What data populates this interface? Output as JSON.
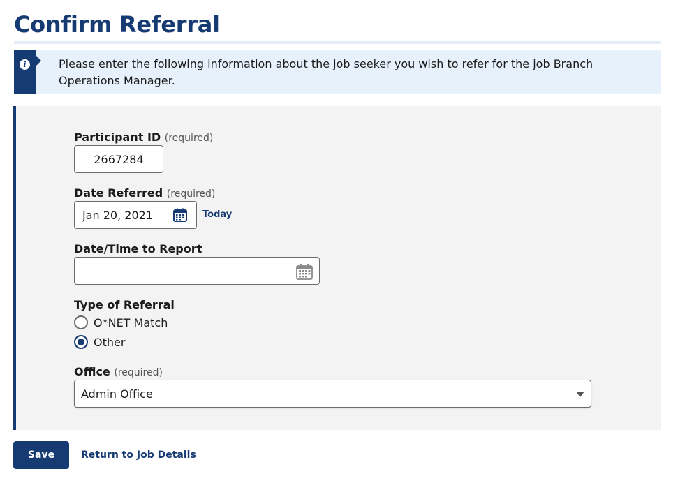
{
  "page": {
    "title": "Confirm Referral"
  },
  "alert": {
    "icon": "info-icon",
    "message": "Please enter the following information about the job seeker you wish to refer for the job Branch Operations Manager."
  },
  "form": {
    "participant_id": {
      "label": "Participant ID",
      "required_note": "(required)",
      "value": "2667284"
    },
    "date_referred": {
      "label": "Date Referred",
      "required_note": "(required)",
      "value": "Jan 20, 2021",
      "calendar_icon": "calendar-icon",
      "today_link": "Today"
    },
    "date_time_to_report": {
      "label": "Date/Time to Report",
      "value": "",
      "calendar_icon": "calendar-icon"
    },
    "type_of_referral": {
      "label": "Type of Referral",
      "options": [
        {
          "label": "O*NET Match",
          "checked": false
        },
        {
          "label": "Other",
          "checked": true
        }
      ]
    },
    "office": {
      "label": "Office",
      "required_note": "(required)",
      "selected": "Admin Office"
    }
  },
  "actions": {
    "save_label": "Save",
    "return_label": "Return to Job Details"
  },
  "colors": {
    "primary": "#163b73",
    "alert_bg": "#e6f1fc",
    "panel_bg": "#f3f3f3"
  }
}
